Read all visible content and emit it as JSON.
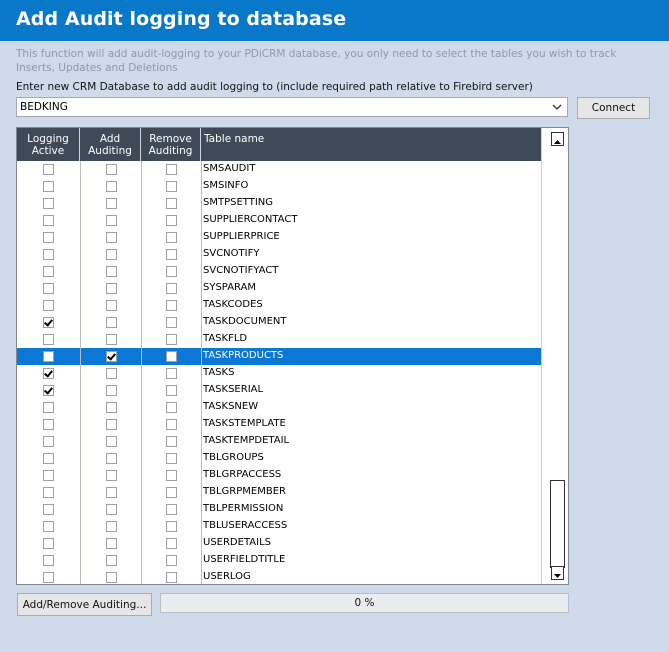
{
  "header": {
    "title": "Add Audit logging to database"
  },
  "description": "This function will add audit-logging to your PDiCRM database, you only need to select the tables you wish to track Inserts, Updates and Deletions",
  "database": {
    "label": "Enter new CRM Database to add audit logging to (include required path relative to Firebird server)",
    "value": "BEDKING",
    "connect_label": "Connect"
  },
  "grid": {
    "columns": [
      {
        "label": "Logging Active"
      },
      {
        "label": "Add Auditing"
      },
      {
        "label": "Remove Auditing"
      },
      {
        "label": "Table name"
      }
    ],
    "rows": [
      {
        "name": "SMSAUDIT",
        "logging_active": false,
        "add_auditing": false,
        "remove_auditing": false,
        "selected": false
      },
      {
        "name": "SMSINFO",
        "logging_active": false,
        "add_auditing": false,
        "remove_auditing": false,
        "selected": false
      },
      {
        "name": "SMTPSETTING",
        "logging_active": false,
        "add_auditing": false,
        "remove_auditing": false,
        "selected": false
      },
      {
        "name": "SUPPLIERCONTACT",
        "logging_active": false,
        "add_auditing": false,
        "remove_auditing": false,
        "selected": false
      },
      {
        "name": "SUPPLIERPRICE",
        "logging_active": false,
        "add_auditing": false,
        "remove_auditing": false,
        "selected": false
      },
      {
        "name": "SVCNOTIFY",
        "logging_active": false,
        "add_auditing": false,
        "remove_auditing": false,
        "selected": false
      },
      {
        "name": "SVCNOTIFYACT",
        "logging_active": false,
        "add_auditing": false,
        "remove_auditing": false,
        "selected": false
      },
      {
        "name": "SYSPARAM",
        "logging_active": false,
        "add_auditing": false,
        "remove_auditing": false,
        "selected": false
      },
      {
        "name": "TASKCODES",
        "logging_active": false,
        "add_auditing": false,
        "remove_auditing": false,
        "selected": false
      },
      {
        "name": "TASKDOCUMENT",
        "logging_active": true,
        "add_auditing": false,
        "remove_auditing": false,
        "selected": false
      },
      {
        "name": "TASKFLD",
        "logging_active": false,
        "add_auditing": false,
        "remove_auditing": false,
        "selected": false
      },
      {
        "name": "TASKPRODUCTS",
        "logging_active": false,
        "add_auditing": true,
        "remove_auditing": false,
        "selected": true
      },
      {
        "name": "TASKS",
        "logging_active": true,
        "add_auditing": false,
        "remove_auditing": false,
        "selected": false
      },
      {
        "name": "TASKSERIAL",
        "logging_active": true,
        "add_auditing": false,
        "remove_auditing": false,
        "selected": false
      },
      {
        "name": "TASKSNEW",
        "logging_active": false,
        "add_auditing": false,
        "remove_auditing": false,
        "selected": false
      },
      {
        "name": "TASKSTEMPLATE",
        "logging_active": false,
        "add_auditing": false,
        "remove_auditing": false,
        "selected": false
      },
      {
        "name": "TASKTEMPDETAIL",
        "logging_active": false,
        "add_auditing": false,
        "remove_auditing": false,
        "selected": false
      },
      {
        "name": "TBLGROUPS",
        "logging_active": false,
        "add_auditing": false,
        "remove_auditing": false,
        "selected": false
      },
      {
        "name": "TBLGRPACCESS",
        "logging_active": false,
        "add_auditing": false,
        "remove_auditing": false,
        "selected": false
      },
      {
        "name": "TBLGRPMEMBER",
        "logging_active": false,
        "add_auditing": false,
        "remove_auditing": false,
        "selected": false
      },
      {
        "name": "TBLPERMISSION",
        "logging_active": false,
        "add_auditing": false,
        "remove_auditing": false,
        "selected": false
      },
      {
        "name": "TBLUSERACCESS",
        "logging_active": false,
        "add_auditing": false,
        "remove_auditing": false,
        "selected": false
      },
      {
        "name": "USERDETAILS",
        "logging_active": false,
        "add_auditing": false,
        "remove_auditing": false,
        "selected": false
      },
      {
        "name": "USERFIELDTITLE",
        "logging_active": false,
        "add_auditing": false,
        "remove_auditing": false,
        "selected": false
      },
      {
        "name": "USERLOG",
        "logging_active": false,
        "add_auditing": false,
        "remove_auditing": false,
        "selected": false
      }
    ]
  },
  "actions": {
    "add_remove_label": "Add/Remove Auditing..."
  },
  "progress": {
    "value": 0,
    "text": "0 %"
  },
  "colors": {
    "header_bg": "#0a78c8",
    "grid_header_bg": "#3f4a58",
    "selected_row": "#0a78d4",
    "body_bg": "#cfdbea"
  },
  "icons": {
    "select_toggle": "chevron-down-icon",
    "scroll_up": "scroll-up-icon",
    "scroll_down": "scroll-down-icon"
  }
}
